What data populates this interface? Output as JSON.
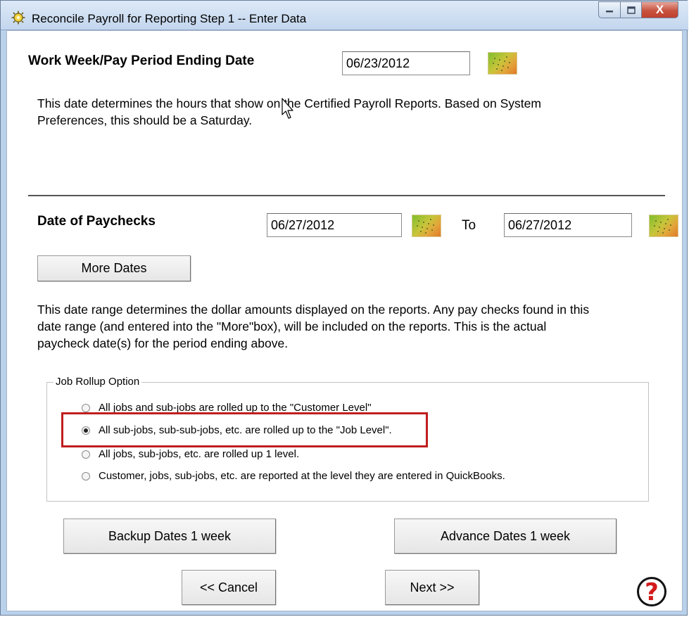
{
  "window": {
    "title": "Reconcile Payroll for Reporting Step 1 -- Enter Data",
    "controls": {
      "minimize": "–",
      "maximize": "□",
      "close": "X"
    }
  },
  "work_week": {
    "label": "Work Week/Pay Period Ending Date",
    "date_value": "06/23/2012",
    "description_line1": "This date determines the hours that show on the Certified Payroll Reports.  Based on System",
    "description_line2": "Preferences, this should be a Saturday."
  },
  "paychecks": {
    "label": "Date of Paychecks",
    "from_value": "06/27/2012",
    "to_label": "To",
    "to_value": "06/27/2012",
    "more_dates_label": "More Dates",
    "description_line1": "This date range determines the dollar amounts displayed on the reports.  Any pay checks found in this",
    "description_line2": "date range (and entered into the \"More\"box), will be included on the reports.  This is the actual",
    "description_line3": "paycheck date(s) for the period ending above."
  },
  "job_rollup": {
    "caption": "Job Rollup Option",
    "options": [
      {
        "label": "All jobs and sub-jobs are rolled up to the \"Customer Level\"",
        "selected": false
      },
      {
        "label": "All sub-jobs, sub-sub-jobs, etc. are rolled up to the \"Job Level\".",
        "selected": true
      },
      {
        "label": "All jobs, sub-jobs, etc. are rolled up 1 level.",
        "selected": false
      },
      {
        "label": "Customer, jobs, sub-jobs, etc. are reported at the level they are entered in QuickBooks.",
        "selected": false
      }
    ]
  },
  "buttons": {
    "backup": "Backup Dates 1 week",
    "advance": "Advance Dates 1 week",
    "cancel": "<< Cancel",
    "next": "Next >>",
    "help": "?"
  },
  "colors": {
    "highlight_border": "#c01e1e",
    "help_mark": "#d21b1b",
    "titlebar": "#c3d6ee"
  },
  "icons": {
    "app": "gear-sun-icon",
    "calendar": "calendar-icon",
    "help": "help-icon",
    "cursor": "mouse-pointer-icon"
  }
}
